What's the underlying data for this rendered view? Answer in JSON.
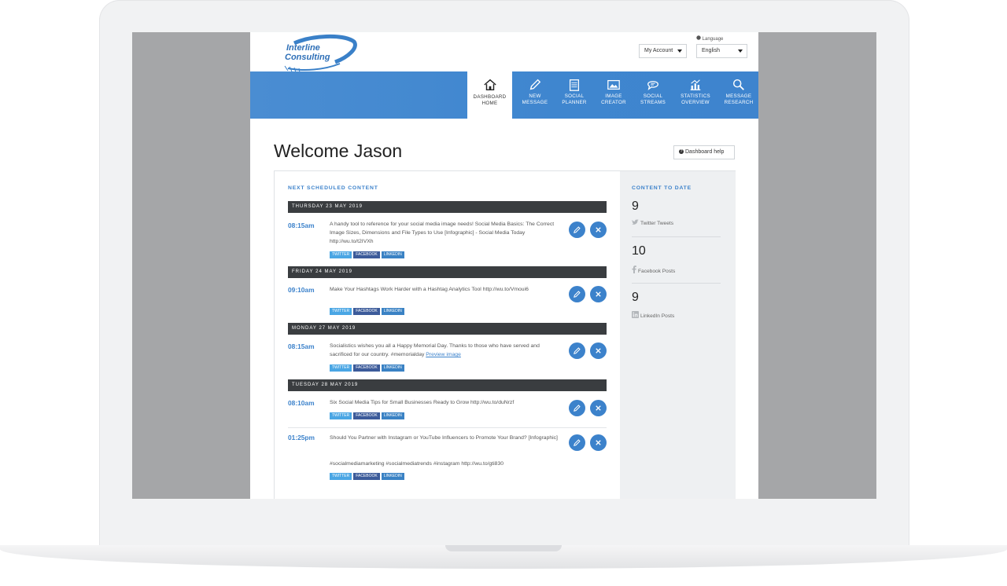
{
  "header": {
    "logo_line1": "Interline",
    "logo_line2": "Consulting",
    "account_label": "My Account",
    "language_label": "Language",
    "language_value": "English"
  },
  "nav": [
    {
      "label_1": "DASHBOARD",
      "label_2": "HOME",
      "icon": "home-icon",
      "active": true
    },
    {
      "label_1": "NEW",
      "label_2": "MESSAGE",
      "icon": "pencil-icon"
    },
    {
      "label_1": "SOCIAL",
      "label_2": "PLANNER",
      "icon": "calendar-icon"
    },
    {
      "label_1": "IMAGE",
      "label_2": "CREATOR",
      "icon": "image-icon"
    },
    {
      "label_1": "SOCIAL",
      "label_2": "STREAMS",
      "icon": "chat-icon"
    },
    {
      "label_1": "STATISTICS",
      "label_2": "OVERVIEW",
      "icon": "chart-icon"
    },
    {
      "label_1": "MESSAGE",
      "label_2": "RESEARCH",
      "icon": "search-icon"
    }
  ],
  "main": {
    "welcome": "Welcome Jason",
    "help_label": "Dashboard help",
    "scheduled_title": "NEXT SCHEDULED CONTENT",
    "content_title": "CONTENT TO DATE"
  },
  "schedule": [
    {
      "date": "THURSDAY 23 MAY 2019",
      "entries": [
        {
          "time": "08:15am",
          "text": "A handy tool to reference for your social media image needs! Social Media Basics: The Correct Image Sizes, Dimensions and File Types to Use [Infographic] - Social Media Today http://wu.to/t2IVXh"
        }
      ]
    },
    {
      "date": "FRIDAY 24 MAY 2019",
      "entries": [
        {
          "time": "09:10am",
          "text": "Make Your Hashtags Work Harder with a Hashtag Analytics Tool http://wu.to/Vmoui6"
        }
      ]
    },
    {
      "date": "MONDAY 27 MAY 2019",
      "entries": [
        {
          "time": "08:15am",
          "text": "Socialistics wishes you all a Happy Memorial Day. Thanks to those who have served and sacrificed for our country. #memorialday",
          "link": "Preview image"
        }
      ]
    },
    {
      "date": "TUESDAY 28 MAY 2019",
      "entries": [
        {
          "time": "08:10am",
          "text": "Six Social Media Tips for Small Businesses Ready to Grow http://wu.to/duNrzf"
        },
        {
          "time": "01:25pm",
          "text": "Should You Partner with Instagram or YouTube Influencers to Promote Your Brand? [Infographic]",
          "text2": "#socialmediamarketing #socialmediatrends #instagram http://wu.to/gti830"
        }
      ]
    }
  ],
  "tags": {
    "twitter": "TWITTER",
    "facebook": "FACEBOOK",
    "linkedin": "LINKEDIN"
  },
  "stats": [
    {
      "value": "9",
      "label": "Twitter Tweets",
      "icon": "twitter-icon"
    },
    {
      "value": "10",
      "label": "Facebook Posts",
      "icon": "facebook-icon"
    },
    {
      "value": "9",
      "label": "LinkedIn Posts",
      "icon": "linkedin-icon"
    }
  ],
  "colors": {
    "accent": "#3c82cb",
    "nav_bg": "#4289d0",
    "date_bar": "#3a3d40",
    "twitter": "#4aa6e4",
    "facebook": "#3c5b9a"
  }
}
